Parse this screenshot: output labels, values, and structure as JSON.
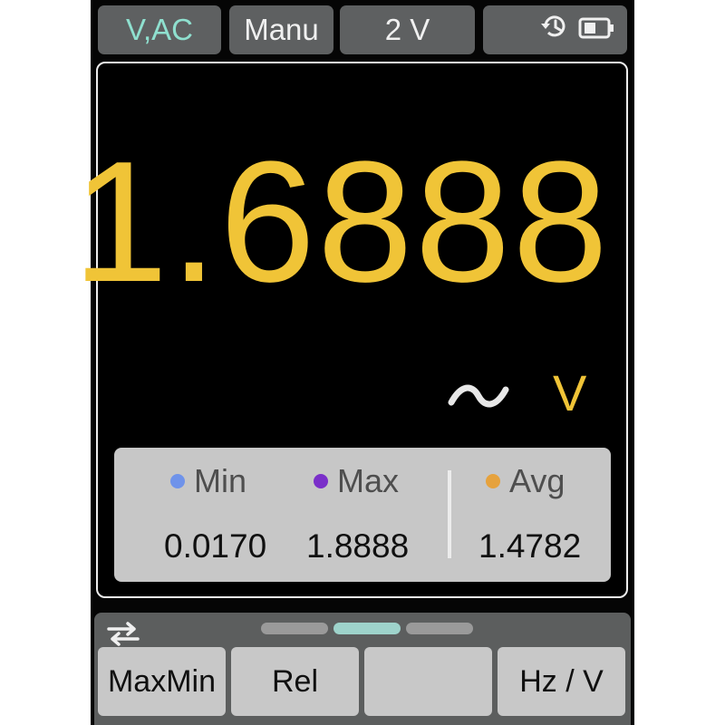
{
  "top_bar": {
    "mode_label": "V,AC",
    "range_mode_label": "Manu",
    "range_label": "2 V",
    "status_icons": [
      "history-clock-icon",
      "battery-icon"
    ]
  },
  "display": {
    "reading": "1.6888",
    "ac_symbol": "~",
    "unit": "V"
  },
  "stats": {
    "min": {
      "label": "Min",
      "value": "0.0170",
      "color": "#6f93ea"
    },
    "max": {
      "label": "Max",
      "value": "1.8888",
      "color": "#7a2fc9"
    },
    "avg": {
      "label": "Avg",
      "value": "1.4782",
      "color": "#e6a23d"
    }
  },
  "softkeys": {
    "page_indicator": {
      "pages": 3,
      "active": 2
    },
    "keys": [
      "MaxMin",
      "Rel",
      "",
      "Hz / V"
    ],
    "swap_icon": "swap-arrows-icon"
  },
  "colors": {
    "reading": "#f0c437",
    "mode_text": "#8fe0cf",
    "button_bg": "#5e6061",
    "softkey_bg": "#c8c8c8"
  }
}
